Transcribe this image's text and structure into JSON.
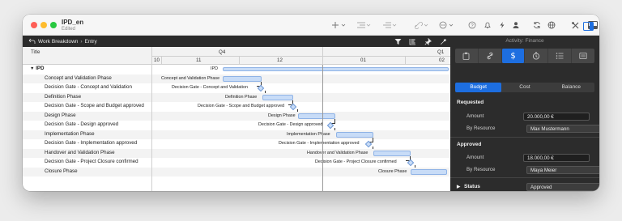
{
  "app": {
    "document_title": "IPD_en",
    "document_subtitle": "Edited"
  },
  "left_toolbar": {
    "breadcrumb": [
      "Work Breakdown",
      "Entry"
    ]
  },
  "table": {
    "title_header": "Title",
    "quarters": [
      "Q4",
      "Q1"
    ],
    "months": [
      "10",
      "11",
      "12",
      "01",
      "02"
    ],
    "rows": [
      {
        "title": "IPD",
        "gantt_label": "IPD",
        "type": "summary"
      },
      {
        "title": "Concept and Validation Phase",
        "gantt_label": "Concept and Validation Phase",
        "type": "task"
      },
      {
        "title": "Decision Gate - Concept and Validation",
        "gantt_label": "Decision Gate - Concept and Validation",
        "type": "milestone"
      },
      {
        "title": "Definition Phase",
        "gantt_label": "Definition Phase",
        "type": "task"
      },
      {
        "title": "Decision Gate - Scope and Budget approved",
        "gantt_label": "Decision Gate - Scope and Budget approved",
        "type": "milestone"
      },
      {
        "title": "Design Phase",
        "gantt_label": "Design Phase",
        "type": "task"
      },
      {
        "title": "Decision Gate - Design approved",
        "gantt_label": "Decision Gate - Design approved",
        "type": "milestone"
      },
      {
        "title": "Implementation Phase",
        "gantt_label": "Implementation Phase",
        "type": "task"
      },
      {
        "title": "Decision Gate - Implementation approved",
        "gantt_label": "Decision Gate - Implementation approved",
        "type": "milestone"
      },
      {
        "title": "Handover and Validation Phase",
        "gantt_label": "Handover and Validation Phase",
        "type": "task"
      },
      {
        "title": "Decision Gate - Project Closure confirmed",
        "gantt_label": "Decision Gate - Project Closure confirmed",
        "type": "milestone"
      },
      {
        "title": "Closure Phase",
        "gantt_label": "Closure Phase",
        "type": "task"
      }
    ]
  },
  "inspector": {
    "title": "Activity: Finance",
    "segments": [
      "Budget",
      "Cost",
      "Balance"
    ],
    "requested": {
      "heading": "Requested",
      "amount_label": "Amount",
      "amount_value": "20.000,00 €",
      "resource_label": "By Resource",
      "resource_value": "Max Mustermann"
    },
    "approved": {
      "heading": "Approved",
      "amount_label": "Amount",
      "amount_value": "18.000,00 €",
      "resource_label": "By Resource",
      "resource_value": "Maya Meier"
    },
    "status": {
      "label": "Status",
      "value": "Approved"
    }
  },
  "colors": {
    "accent": "#1d6ee0",
    "bar_fill": "#c8dcf7",
    "bar_border": "#8fb3e6"
  }
}
